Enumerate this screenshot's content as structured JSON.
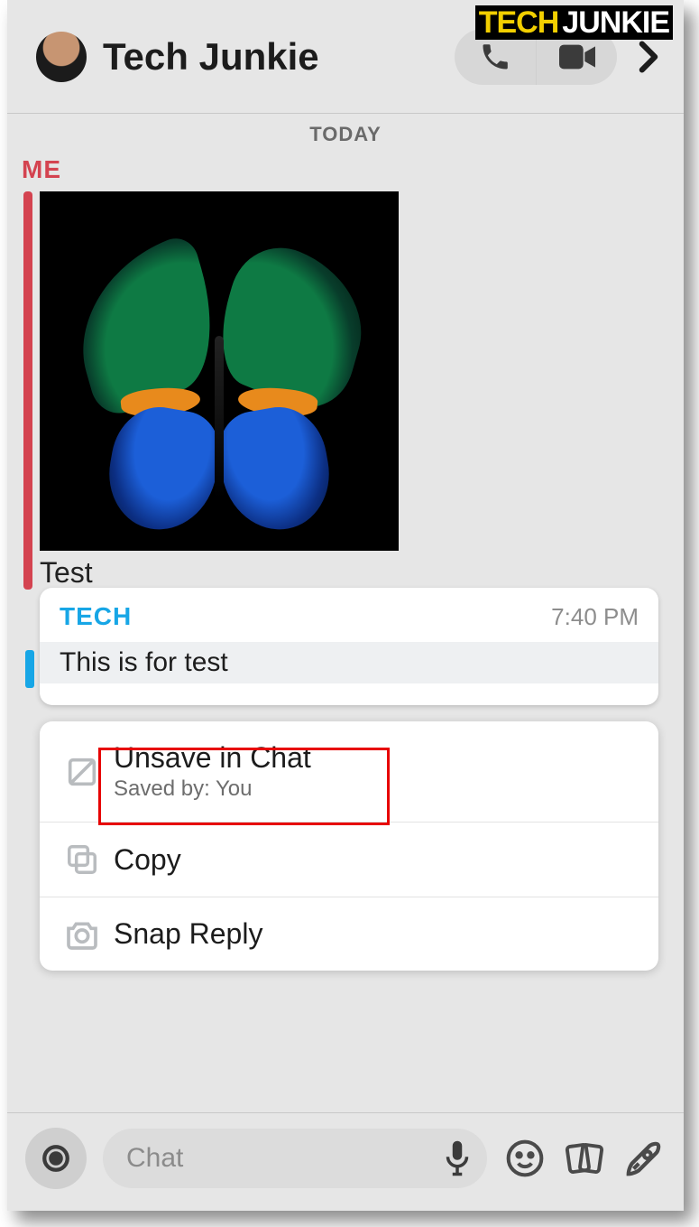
{
  "watermark": {
    "part1": "TECH",
    "part2": "JUNKIE"
  },
  "header": {
    "title": "Tech Junkie"
  },
  "date_label": "TODAY",
  "sender_me": "ME",
  "message": {
    "caption": "Test"
  },
  "popover": {
    "sender": "TECH",
    "time": "7:40 PM",
    "body": "This is for test"
  },
  "menu": {
    "unsave": {
      "title": "Unsave in Chat",
      "subtitle": "Saved by: You"
    },
    "copy": {
      "title": "Copy"
    },
    "snapreply": {
      "title": "Snap Reply"
    }
  },
  "input": {
    "placeholder": "Chat"
  }
}
